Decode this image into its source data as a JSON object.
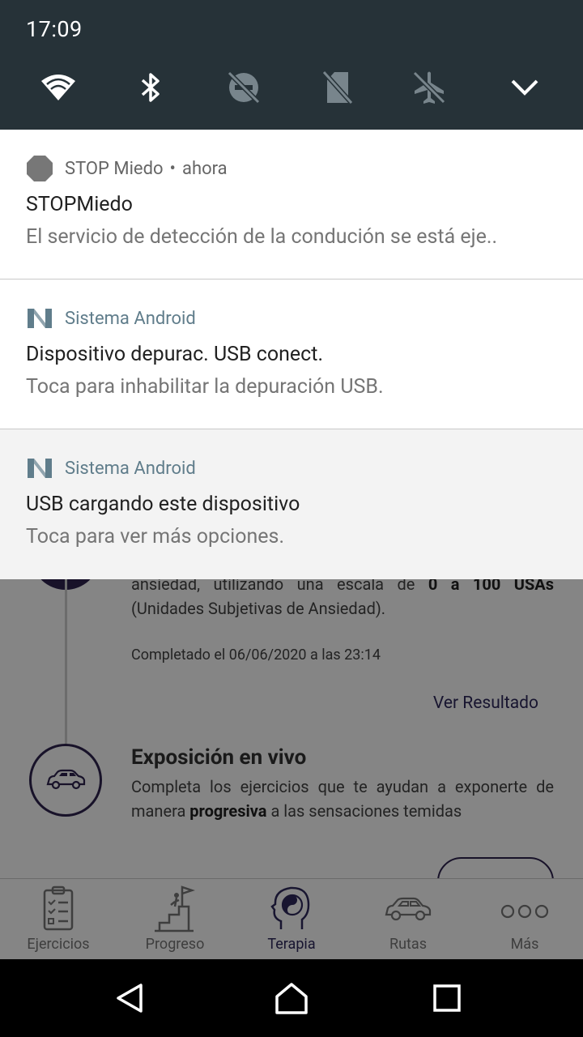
{
  "status": {
    "time": "17:09"
  },
  "quick_settings": [
    {
      "icon": "wifi-icon"
    },
    {
      "icon": "bluetooth-icon"
    },
    {
      "icon": "do-not-disturb-off-icon"
    },
    {
      "icon": "no-sim-icon"
    },
    {
      "icon": "airplane-mode-off-icon"
    },
    {
      "icon": "expand-chevron-icon"
    }
  ],
  "notifications": [
    {
      "app": "STOP Miedo",
      "dot": "•",
      "time": "ahora",
      "title": "STOPMiedo",
      "text": "El servicio de detección de la condución se está eje.."
    },
    {
      "app": "Sistema Android",
      "title": "Dispositivo depurac. USB conect.",
      "text": "Toca para inhabilitar la depuración USB."
    },
    {
      "app": "Sistema Android",
      "title": "USB cargando este dispositivo",
      "text": "Toca para ver más opciones."
    }
  ],
  "background_app": {
    "step1_text_pre": "ansiedad, utilizando una escala de ",
    "step1_text_bold": "0 a 100 USAs",
    "step1_text_post": " (Unidades Subjetivas de Ansiedad).",
    "completed": "Completado el 06/06/2020 a las 23:14",
    "view_result": "Ver Resultado",
    "step2_title": "Exposición en vivo",
    "step2_text_pre": "Completa los ejercicios que te ayudan a exponerte de manera ",
    "step2_text_bold": "progresiva",
    "step2_text_post": " a las sensaciones temidas"
  },
  "bottom_nav": [
    {
      "label": "Ejercicios",
      "icon": "clipboard-checklist-icon"
    },
    {
      "label": "Progreso",
      "icon": "stairs-flag-icon"
    },
    {
      "label": "Terapia",
      "icon": "head-yin-yang-icon",
      "active": true
    },
    {
      "label": "Rutas",
      "icon": "car-icon"
    },
    {
      "label": "Más",
      "icon": "more-dots-icon"
    }
  ],
  "colors": {
    "accent": "#2e2a5c",
    "shade": "#263238"
  }
}
